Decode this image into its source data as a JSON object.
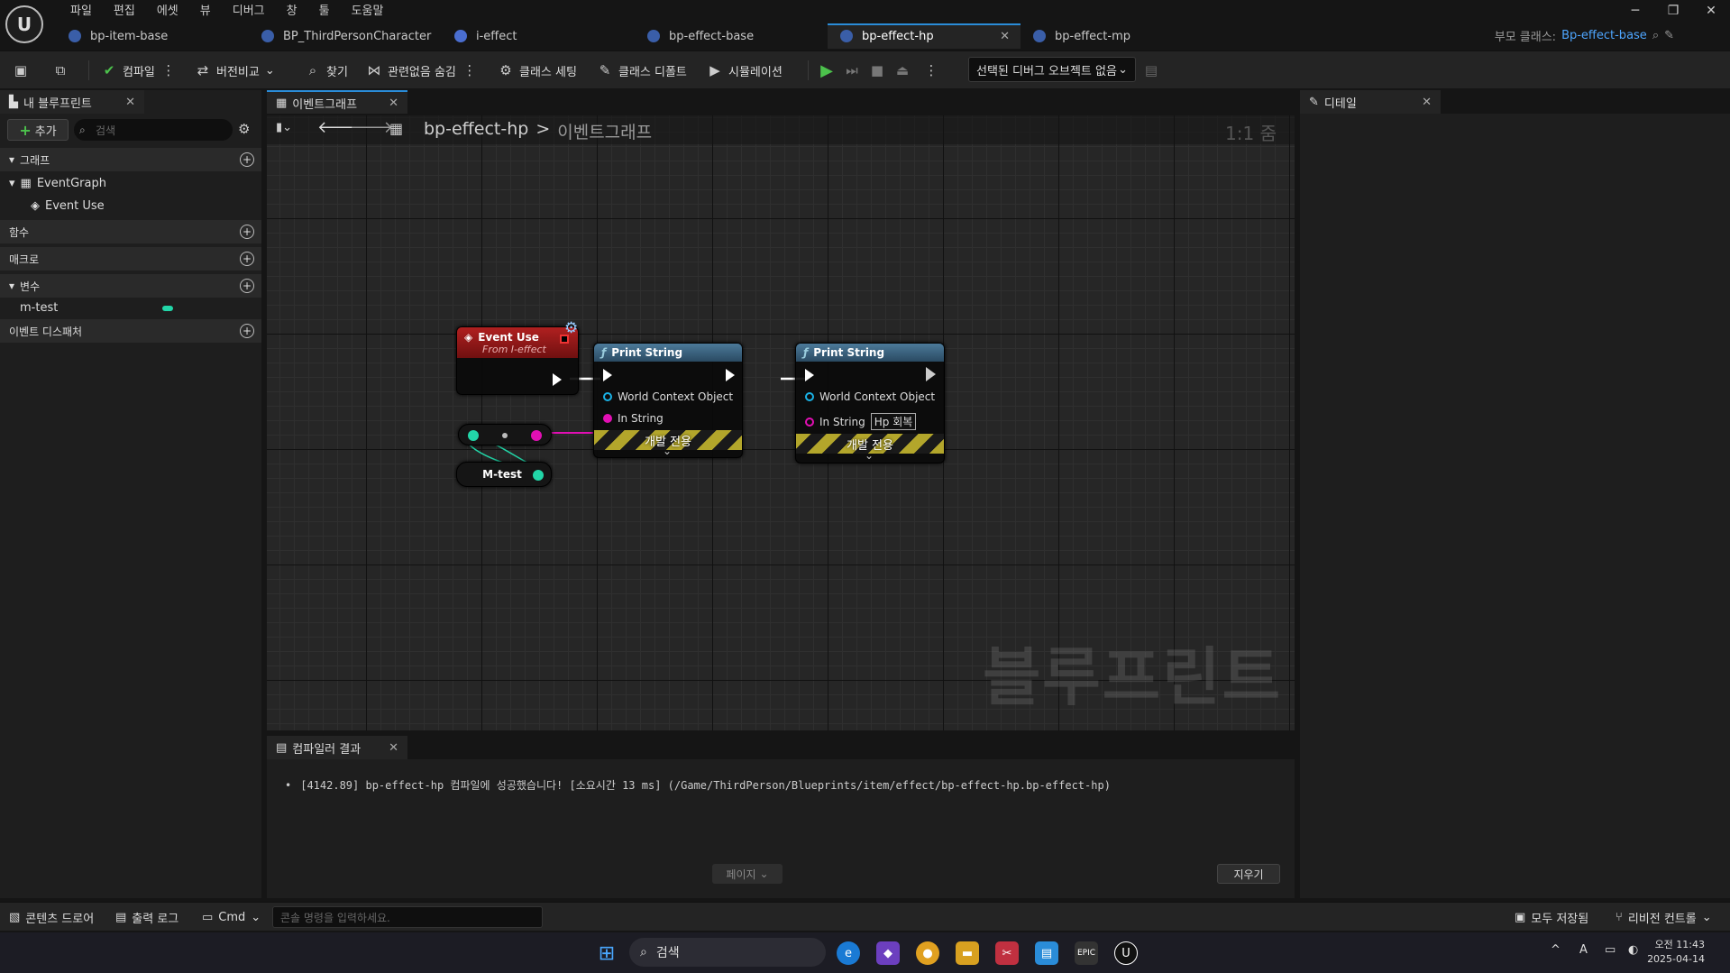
{
  "menu": [
    "파일",
    "편집",
    "에셋",
    "뷰",
    "디버그",
    "창",
    "툴",
    "도움말"
  ],
  "tabs": [
    {
      "label": "bp-item-base",
      "icon": "blueprint-icon"
    },
    {
      "label": "BP_ThirdPersonCharacter",
      "icon": "character-blueprint-icon"
    },
    {
      "label": "i-effect",
      "icon": "interface-icon"
    },
    {
      "label": "bp-effect-base",
      "icon": "blueprint-icon"
    },
    {
      "label": "bp-effect-hp",
      "icon": "blueprint-icon",
      "active": true
    },
    {
      "label": "bp-effect-mp",
      "icon": "blueprint-icon"
    }
  ],
  "parent_class": {
    "label": "부모 클래스:",
    "value": "Bp-effect-base"
  },
  "toolbar": {
    "compile": "컴파일",
    "diff": "버전비교",
    "find": "찾기",
    "hide_unrelated": "관련없음 숨김",
    "class_settings": "클래스 세팅",
    "class_defaults": "클래스 디폴트",
    "simulation": "시뮬레이션",
    "debug_object": "선택된 디버그 오브젝트 없음"
  },
  "left_panel": {
    "tab": "내 블루프린트",
    "add": "추가",
    "search_placeholder": "검색",
    "graphs_header": "그래프",
    "event_graph": "EventGraph",
    "event_use": "Event Use",
    "functions_header": "함수",
    "macros_header": "매크로",
    "variables_header": "변수",
    "variable_name": "m-test",
    "dispatchers_header": "이벤트 디스패처"
  },
  "graph": {
    "tab": "이벤트그래프",
    "breadcrumb_root": "bp-effect-hp",
    "breadcrumb_sep": ">",
    "breadcrumb_leaf": "이벤트그래프",
    "zoom": "1:1 줌",
    "watermark": "블루프린트",
    "event_node": {
      "title": "Event Use",
      "subtitle": "From I-effect"
    },
    "print1": {
      "title": "Print String",
      "world_context": "World Context Object",
      "in_string": "In String",
      "dev_only": "개발 전용"
    },
    "print2": {
      "title": "Print String",
      "world_context": "World Context Object",
      "in_string": "In String",
      "in_string_value": "Hp 회복",
      "dev_only": "개발 전용"
    },
    "var_node": "M-test"
  },
  "compiler": {
    "tab": "컴파일러 결과",
    "message": "[4142.89] bp-effect-hp 컴파일에 성공했습니다! [소요시간 13 ms] (/Game/ThirdPerson/Blueprints/item/effect/bp-effect-hp.bp-effect-hp)",
    "page": "페이지",
    "clear": "지우기"
  },
  "details": {
    "tab": "디테일"
  },
  "statusbar": {
    "content_drawer": "콘텐츠 드로어",
    "output_log": "출력 로그",
    "cmd": "Cmd",
    "console_placeholder": "콘솔 명령을 입력하세요.",
    "save_all": "모두 저장됨",
    "revision_control": "리비전 컨트롤"
  },
  "taskbar": {
    "search": "검색",
    "time": "오전 11:43",
    "date": "2025-04-14"
  },
  "colors": {
    "accent": "#2a8cd8",
    "event_header": "#a01818",
    "function_header": "#3a6a8a",
    "exec_pin": "#ffffff",
    "string_pin": "#e20fb4",
    "object_pin": "#1ab2e6",
    "float_pin": "#22d6a8"
  }
}
